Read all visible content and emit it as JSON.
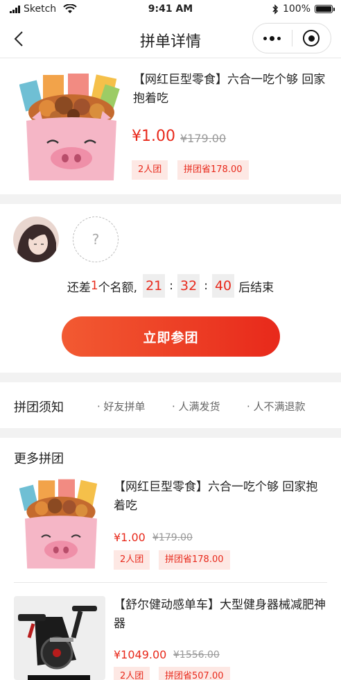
{
  "status_bar": {
    "carrier": "Sketch",
    "time": "9:41 AM",
    "battery": "100%",
    "battery_level": 1.0
  },
  "nav": {
    "title": "拼单详情"
  },
  "product": {
    "title": "【网红巨型零食】六合一吃个够 回家抱着吃",
    "price": "¥1.00",
    "original_price": "¥179.00",
    "tags": [
      "2人团",
      "拼团省178.00"
    ]
  },
  "group": {
    "empty_slot": "?",
    "remaining_prefix": "还差",
    "remaining_count": "1",
    "remaining_suffix": "个名额,",
    "countdown": {
      "hours": "21",
      "minutes": "32",
      "seconds": "40"
    },
    "separator": ":",
    "ends_label": "后结束",
    "join_button": "立即参团"
  },
  "rules": {
    "title": "拼团须知",
    "items": [
      "· 好友拼单",
      "· 人满发货",
      "· 人不满退款"
    ]
  },
  "more": {
    "title": "更多拼团",
    "items": [
      {
        "title": "【网红巨型零食】六合一吃个够 回家抱着吃",
        "price": "¥1.00",
        "original_price": "¥179.00",
        "tags": [
          "2人团",
          "拼团省178.00"
        ]
      },
      {
        "title": "【舒尔健动感单车】大型健身器械减肥神器",
        "price": "¥1049.00",
        "original_price": "¥1556.00",
        "tags": [
          "2人团",
          "拼团省507.00"
        ]
      }
    ]
  },
  "colors": {
    "accent": "#e8291b",
    "tag_bg": "#fde8e4",
    "page_bg": "#f2f2f2"
  }
}
